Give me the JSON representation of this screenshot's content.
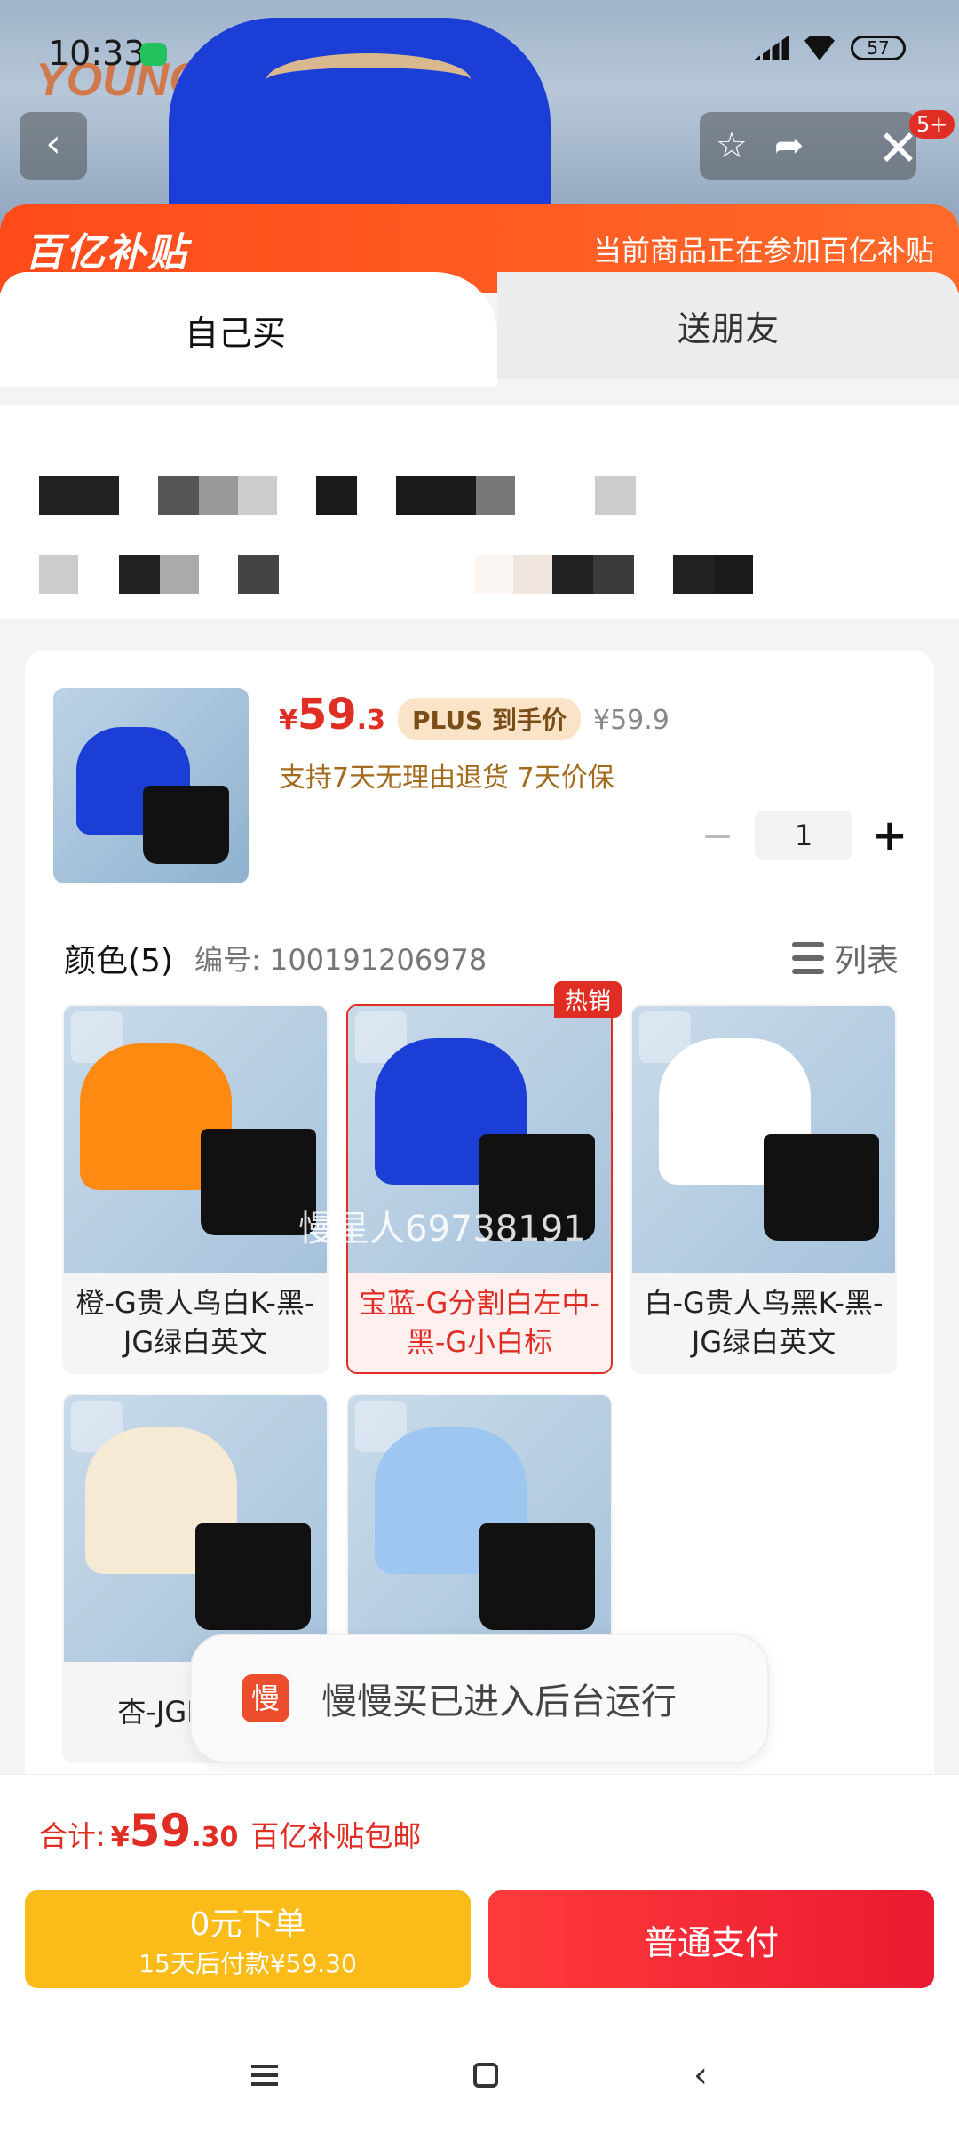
{
  "status_bar": {
    "time": "10:33",
    "battery": "57"
  },
  "top_bar": {
    "badge": "5+"
  },
  "subsidy": {
    "logo": "百亿补贴",
    "text": "当前商品正在参加百亿补贴"
  },
  "tabs": [
    {
      "label": "自己买"
    },
    {
      "label": "送朋友"
    }
  ],
  "product": {
    "price_symbol": "¥",
    "price_int": "59",
    "price_dec": ".3",
    "plus_tag": "PLUS 到手价",
    "original_price": "¥59.9",
    "support": "支持7天无理由退货  7天价保",
    "quantity": "1"
  },
  "color_section": {
    "title": "颜色(5)",
    "code": "编号: 100191206978",
    "list_label": "列表",
    "hot_tag": "热销",
    "options": [
      {
        "label": "橙-G贵人鸟白K-黑-JG绿白英文",
        "shirt_color": "#ff8a12"
      },
      {
        "label": "宝蓝-G分割白左中-黑-G小白标",
        "shirt_color": "#1b3fd6"
      },
      {
        "label": "白-G贵人鸟黑K-黑-JG绿白英文",
        "shirt_color": "#ffffff"
      },
      {
        "label": "杏-JGK-黑-G",
        "shirt_color": "#f6ead4"
      },
      {
        "label": "",
        "shirt_color": "#9dc7f0"
      }
    ]
  },
  "watermark": "慢星人69738191",
  "toast": {
    "icon": "慢",
    "text": "慢慢买已进入后台运行"
  },
  "footer": {
    "total_label": "合计:",
    "total_symbol": "¥",
    "total_int": "59",
    "total_dec": ".30",
    "free_shipping": "百亿补贴包邮",
    "later_line1": "0元下单",
    "later_line2": "15天后付款¥59.30",
    "pay_label": "普通支付"
  },
  "colors": {
    "accent": "#e02e24",
    "subsidy": "#ff4a1a",
    "later_btn": "#fbbc1a"
  }
}
